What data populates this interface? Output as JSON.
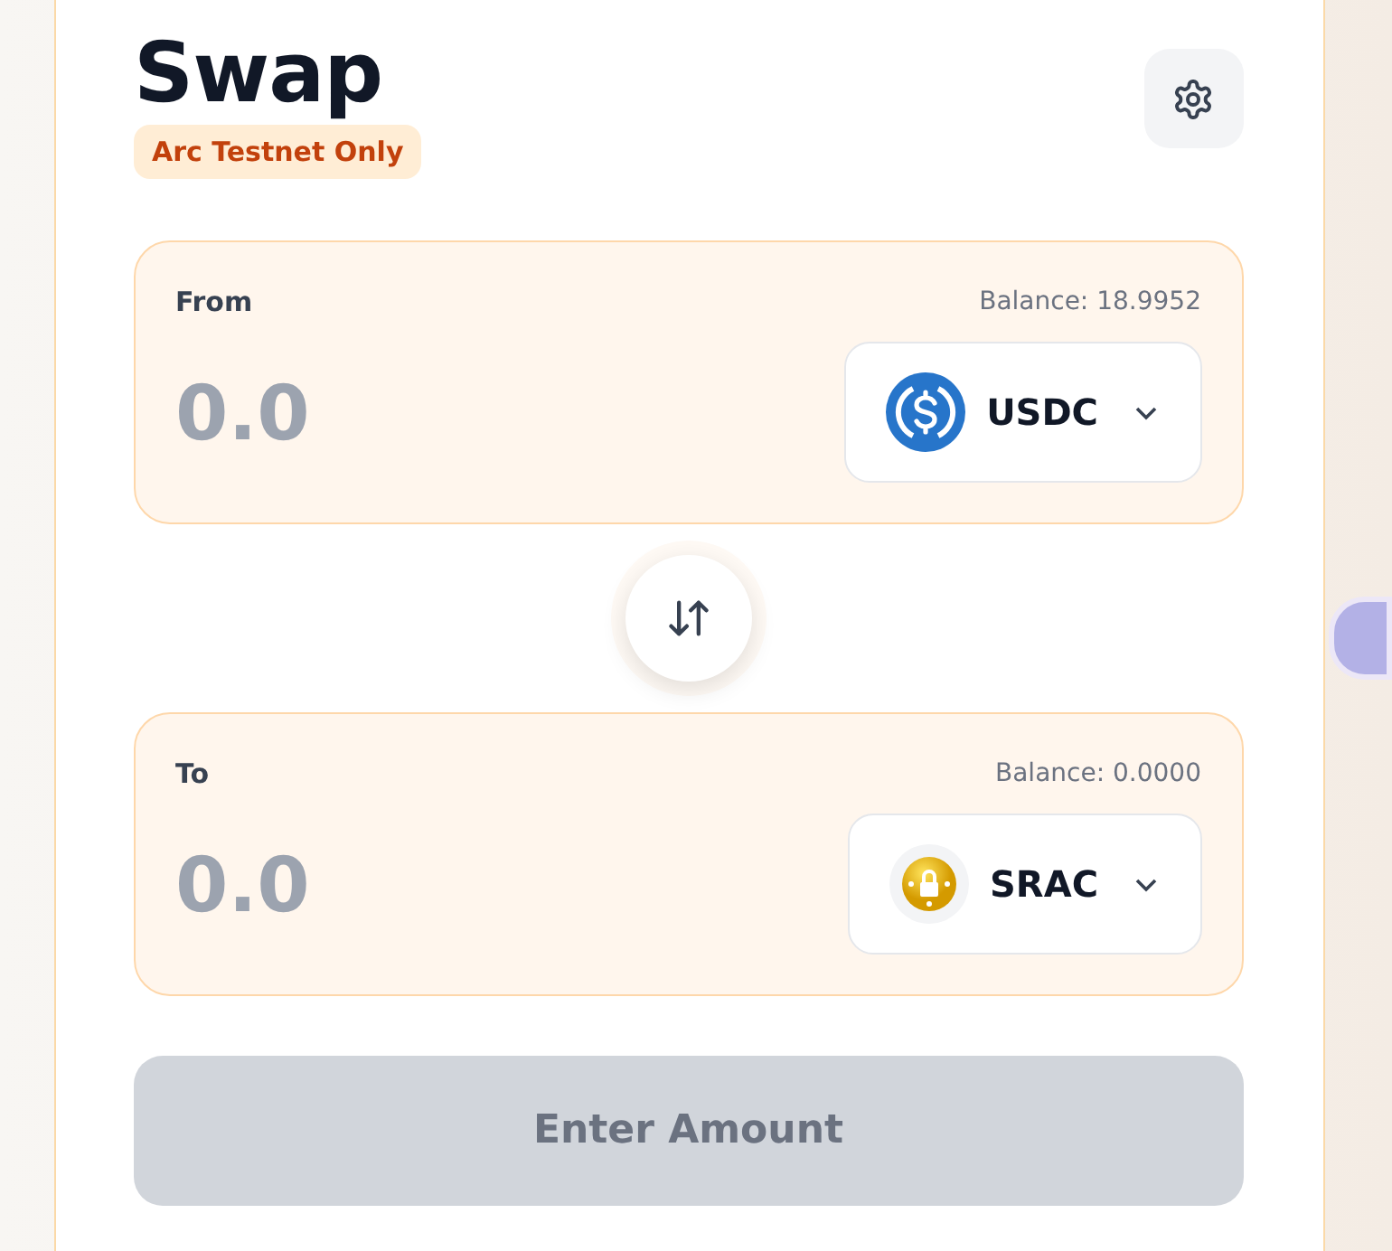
{
  "title": "Swap",
  "badge": "Arc Testnet Only",
  "panels": [
    {
      "label": "From",
      "balance": "Balance: 18.9952",
      "placeholder": "0.0",
      "token": {
        "symbol": "USDC",
        "kind": "usdc"
      }
    },
    {
      "label": "To",
      "balance": "Balance: 0.0000",
      "placeholder": "0.0",
      "token": {
        "symbol": "SRAC",
        "kind": "srac"
      }
    }
  ],
  "submit": {
    "label": "Enter Amount",
    "disabled": true
  }
}
